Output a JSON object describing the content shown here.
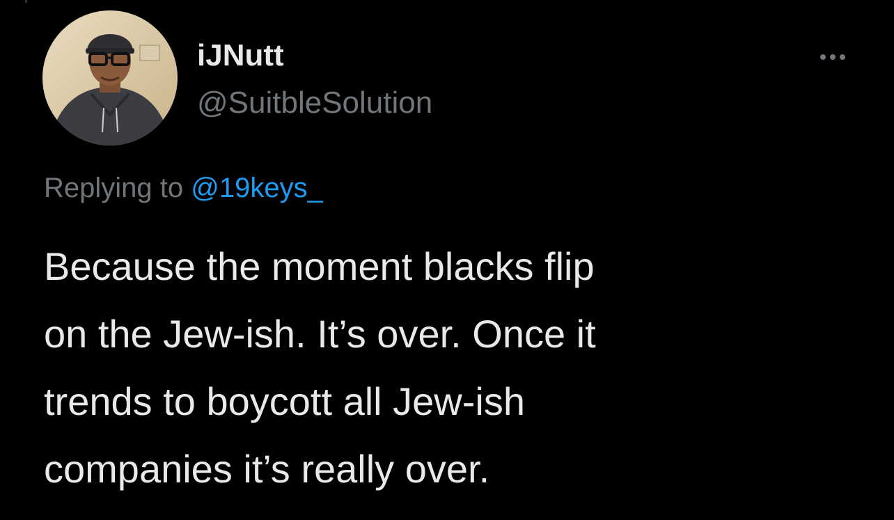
{
  "tweet": {
    "author": {
      "display_name": "iJNutt",
      "handle": "@SuitbleSolution",
      "avatar_icon": "profile-photo"
    },
    "more_icon": "more-horizontal-icon",
    "reply_context": {
      "prefix": "Replying to",
      "mention": "@19keys_"
    },
    "text_lines": [
      "Because the moment blacks flip",
      "on the Jew-ish. It’s over. Once it",
      "trends to boycott all Jew-ish",
      "companies it’s really over."
    ]
  },
  "colors": {
    "background": "#000000",
    "primary_text": "#E7E9EA",
    "secondary_text": "#71767B",
    "accent": "#1D9BF0"
  }
}
